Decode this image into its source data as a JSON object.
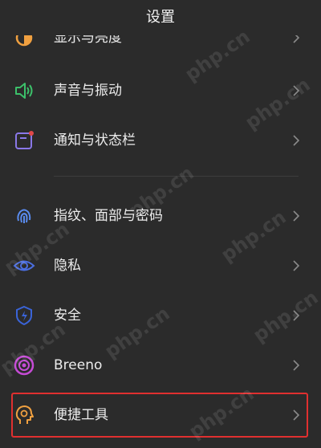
{
  "header": {
    "title": "设置"
  },
  "rows": [
    {
      "label": "显示与亮度",
      "icon": "brightness-icon"
    },
    {
      "label": "声音与振动",
      "icon": "speaker-icon"
    },
    {
      "label": "通知与状态栏",
      "icon": "notification-icon"
    },
    {
      "label": "指纹、面部与密码",
      "icon": "fingerprint-icon"
    },
    {
      "label": "隐私",
      "icon": "eye-icon"
    },
    {
      "label": "安全",
      "icon": "shield-bolt-icon"
    },
    {
      "label": "Breeno",
      "icon": "breeno-icon"
    },
    {
      "label": "便捷工具",
      "icon": "head-gear-icon"
    }
  ],
  "watermark": {
    "text": "php.cn"
  },
  "colors": {
    "background": "#2b2b2b",
    "highlight": "#e03030",
    "speaker": "#3cc06a",
    "notification": "#8a78e8",
    "fingerprint": "#5a8cf0",
    "privacy": "#4b6ee0",
    "security": "#3a64d8",
    "breeno": "#c64bd6",
    "tools": "#f0a040"
  }
}
